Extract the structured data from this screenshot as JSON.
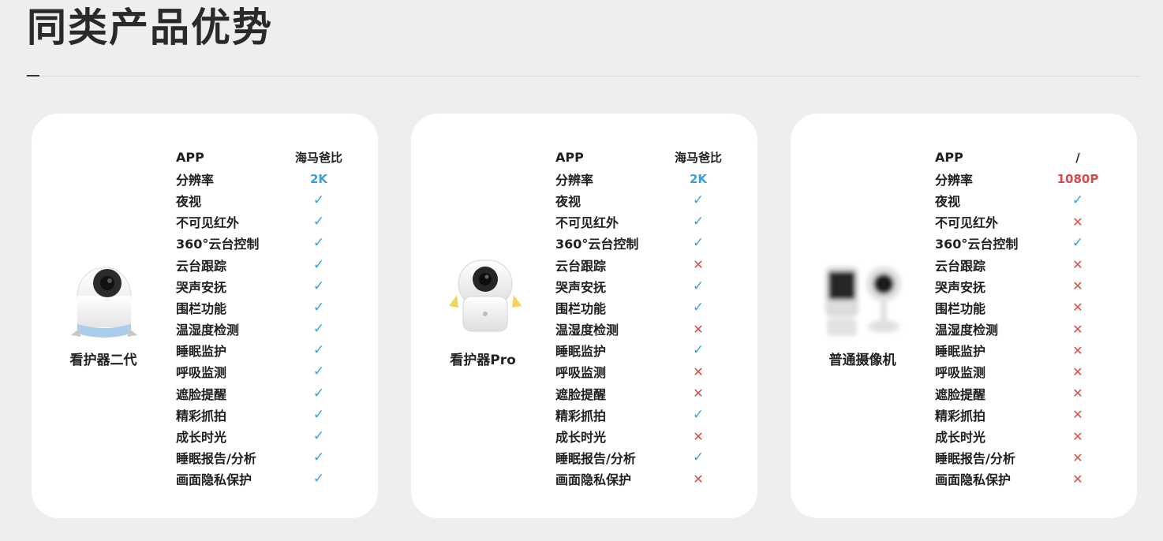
{
  "page": {
    "title": "同类产品优势"
  },
  "colors": {
    "check": "#3aa1d6",
    "cross": "#d94a4a",
    "highlight_blue": "#3aa1d6",
    "highlight_red": "#d94a4a"
  },
  "icons": {
    "check": "✓",
    "cross": "✕"
  },
  "cards": [
    {
      "product_name": "看护器二代",
      "product_image": "baby-monitor-gen2",
      "specs": [
        {
          "label": "APP",
          "value": "海马爸比",
          "kind": "text"
        },
        {
          "label": "分辨率",
          "value": "2K",
          "kind": "blue"
        },
        {
          "label": "夜视",
          "value": "✓",
          "kind": "check"
        },
        {
          "label": "不可见红外",
          "value": "✓",
          "kind": "check"
        },
        {
          "label": "360°云台控制",
          "value": "✓",
          "kind": "check"
        },
        {
          "label": "云台跟踪",
          "value": "✓",
          "kind": "check"
        },
        {
          "label": "哭声安抚",
          "value": "✓",
          "kind": "check"
        },
        {
          "label": "围栏功能",
          "value": "✓",
          "kind": "check"
        },
        {
          "label": "温湿度检测",
          "value": "✓",
          "kind": "check"
        },
        {
          "label": "睡眠监护",
          "value": "✓",
          "kind": "check"
        },
        {
          "label": "呼吸监测",
          "value": "✓",
          "kind": "check"
        },
        {
          "label": "遮脸提醒",
          "value": "✓",
          "kind": "check"
        },
        {
          "label": "精彩抓拍",
          "value": "✓",
          "kind": "check"
        },
        {
          "label": "成长时光",
          "value": "✓",
          "kind": "check"
        },
        {
          "label": "睡眠报告/分析",
          "value": "✓",
          "kind": "check"
        },
        {
          "label": "画面隐私保护",
          "value": "✓",
          "kind": "check"
        }
      ]
    },
    {
      "product_name": "看护器Pro",
      "product_image": "baby-monitor-pro",
      "specs": [
        {
          "label": "APP",
          "value": "海马爸比",
          "kind": "text"
        },
        {
          "label": "分辨率",
          "value": "2K",
          "kind": "blue"
        },
        {
          "label": "夜视",
          "value": "✓",
          "kind": "check"
        },
        {
          "label": "不可见红外",
          "value": "✓",
          "kind": "check"
        },
        {
          "label": "360°云台控制",
          "value": "✓",
          "kind": "check"
        },
        {
          "label": "云台跟踪",
          "value": "✕",
          "kind": "cross"
        },
        {
          "label": "哭声安抚",
          "value": "✓",
          "kind": "check"
        },
        {
          "label": "围栏功能",
          "value": "✓",
          "kind": "check"
        },
        {
          "label": "温湿度检测",
          "value": "✕",
          "kind": "cross"
        },
        {
          "label": "睡眠监护",
          "value": "✓",
          "kind": "check"
        },
        {
          "label": "呼吸监测",
          "value": "✕",
          "kind": "cross"
        },
        {
          "label": "遮脸提醒",
          "value": "✕",
          "kind": "cross"
        },
        {
          "label": "精彩抓拍",
          "value": "✓",
          "kind": "check"
        },
        {
          "label": "成长时光",
          "value": "✕",
          "kind": "cross"
        },
        {
          "label": "睡眠报告/分析",
          "value": "✓",
          "kind": "check"
        },
        {
          "label": "画面隐私保护",
          "value": "✕",
          "kind": "cross"
        }
      ]
    },
    {
      "product_name": "普通摄像机",
      "product_image": "generic-camera-blurred",
      "specs": [
        {
          "label": "APP",
          "value": "/",
          "kind": "text"
        },
        {
          "label": "分辨率",
          "value": "1080P",
          "kind": "red"
        },
        {
          "label": "夜视",
          "value": "✓",
          "kind": "check"
        },
        {
          "label": "不可见红外",
          "value": "✕",
          "kind": "cross"
        },
        {
          "label": "360°云台控制",
          "value": "✓",
          "kind": "check"
        },
        {
          "label": "云台跟踪",
          "value": "✕",
          "kind": "cross"
        },
        {
          "label": "哭声安抚",
          "value": "✕",
          "kind": "cross"
        },
        {
          "label": "围栏功能",
          "value": "✕",
          "kind": "cross"
        },
        {
          "label": "温湿度检测",
          "value": "✕",
          "kind": "cross"
        },
        {
          "label": "睡眠监护",
          "value": "✕",
          "kind": "cross"
        },
        {
          "label": "呼吸监测",
          "value": "✕",
          "kind": "cross"
        },
        {
          "label": "遮脸提醒",
          "value": "✕",
          "kind": "cross"
        },
        {
          "label": "精彩抓拍",
          "value": "✕",
          "kind": "cross"
        },
        {
          "label": "成长时光",
          "value": "✕",
          "kind": "cross"
        },
        {
          "label": "睡眠报告/分析",
          "value": "✕",
          "kind": "cross"
        },
        {
          "label": "画面隐私保护",
          "value": "✕",
          "kind": "cross"
        }
      ]
    }
  ]
}
